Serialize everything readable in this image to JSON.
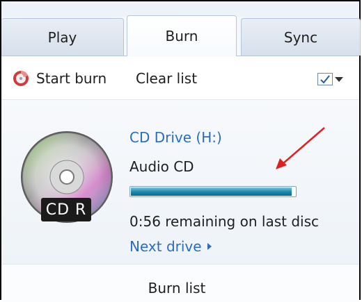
{
  "tabs": [
    {
      "label": "Play"
    },
    {
      "label": "Burn"
    },
    {
      "label": "Sync"
    }
  ],
  "toolbar": {
    "start_burn_label": "Start burn",
    "clear_list_label": "Clear list",
    "burn_icon": "burn-disc-icon",
    "options_icon": "list-options-icon"
  },
  "drive": {
    "name": "CD Drive (H:)",
    "disc_type": "Audio CD",
    "disc_label": "CD R",
    "progress": 0.98,
    "remaining": "0:56 remaining on last disc",
    "next_drive": "Next drive"
  },
  "footer": {
    "title": "Burn list"
  },
  "colors": {
    "link": "#2a6bc4",
    "progress": "#1a86ae",
    "annotation_arrow": "#e02020"
  }
}
